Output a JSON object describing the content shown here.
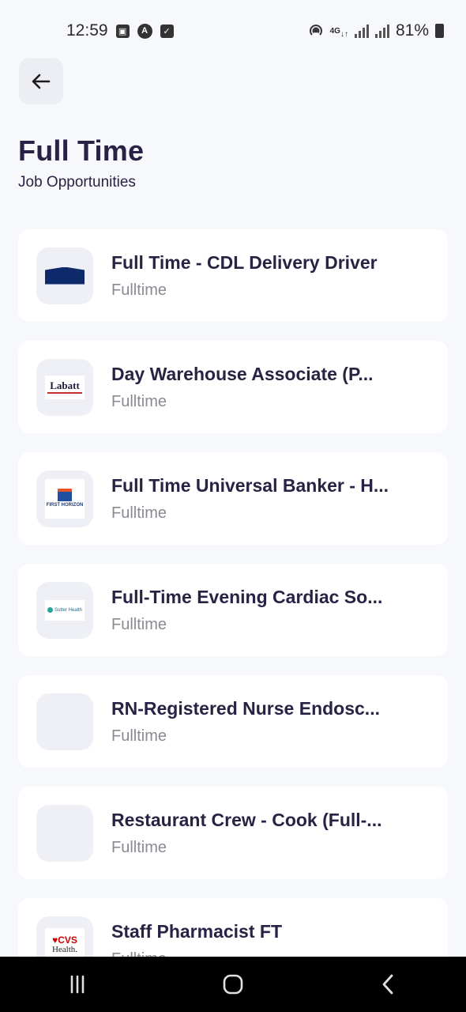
{
  "status_bar": {
    "time": "12:59",
    "battery_text": "81%",
    "network_label": "4G",
    "left_icons": [
      "image-icon",
      "a-icon",
      "check-square-icon"
    ],
    "right_icons": [
      "hotspot-icon",
      "network-4g-icon",
      "signal-icon",
      "signal-icon",
      "battery-icon"
    ]
  },
  "header": {
    "back_icon": "arrow-left-icon",
    "title": "Full Time",
    "subtitle": "Job Opportunities"
  },
  "jobs": [
    {
      "title": "Full Time - CDL Delivery Driver",
      "type": "Fulltime",
      "logo": "navy-roof-logo"
    },
    {
      "title": "Day Warehouse Associate (P...",
      "type": "Fulltime",
      "logo": "labatt-logo",
      "logo_text": "Labatt"
    },
    {
      "title": "Full Time Universal Banker - H...",
      "type": "Fulltime",
      "logo": "first-horizon-logo",
      "logo_text": "FIRST HORIZON"
    },
    {
      "title": "Full-Time Evening Cardiac So...",
      "type": "Fulltime",
      "logo": "sutter-health-logo",
      "logo_text": "Sutter Health"
    },
    {
      "title": "RN-Registered Nurse Endosc...",
      "type": "Fulltime",
      "logo": "empty-logo"
    },
    {
      "title": "Restaurant Crew - Cook (Full-...",
      "type": "Fulltime",
      "logo": "empty-logo"
    },
    {
      "title": "Staff Pharmacist FT",
      "type": "Fulltime",
      "logo": "cvs-health-logo",
      "logo_text_a": "♥CVS",
      "logo_text_b": "Health."
    }
  ],
  "nav": {
    "recents": "recents-icon",
    "home": "home-icon",
    "back": "back-icon"
  }
}
